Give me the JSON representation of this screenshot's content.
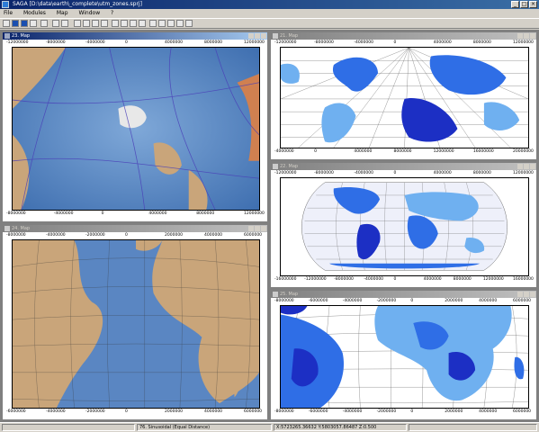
{
  "app": {
    "title": "SAGA [D:\\data\\earth\\_complete\\utm_zones.sprj]"
  },
  "menu": [
    "File",
    "Modules",
    "Map",
    "Window",
    "?"
  ],
  "windows": [
    {
      "title": "23. Map",
      "top_ticks": [
        "-12000000",
        "-8000000",
        "-4000000",
        "0",
        "4000000",
        "8000000",
        "12000000"
      ],
      "bottom_ticks": [
        "-8000000",
        "-4000000",
        "0",
        "4000000",
        "8000000",
        "12000000"
      ]
    },
    {
      "title": "24. Map",
      "top_ticks": [
        "-8000000",
        "-4000000",
        "-2000000",
        "0",
        "2000000",
        "4000000",
        "6000000"
      ],
      "bottom_ticks": [
        "-6000000",
        "-4000000",
        "-2000000",
        "0",
        "2000000",
        "4000000",
        "6000000"
      ]
    },
    {
      "title": "21. Map",
      "top_ticks": [
        "-12000000",
        "-8000000",
        "-4000000",
        "0",
        "4000000",
        "8000000",
        "12000000"
      ],
      "bottom_ticks": [
        "-4000000",
        "0",
        "4000000",
        "8000000",
        "12000000",
        "16000000",
        "20000000"
      ]
    },
    {
      "title": "22. Map",
      "top_ticks": [
        "-12000000",
        "-8000000",
        "-4000000",
        "0",
        "4000000",
        "8000000",
        "12000000"
      ],
      "bottom_ticks": [
        "-16000000",
        "-12000000",
        "-8000000",
        "-4000000",
        "0",
        "4000000",
        "8000000",
        "12000000",
        "16000000"
      ]
    },
    {
      "title": "25. Map",
      "top_ticks": [
        "-8000000",
        "-6000000",
        "-4000000",
        "-2000000",
        "0",
        "2000000",
        "4000000",
        "6000000"
      ],
      "bottom_ticks": [
        "-8000000",
        "-6000000",
        "-4000000",
        "-2000000",
        "0",
        "2000000",
        "4000000",
        "6000000"
      ]
    }
  ],
  "status": {
    "layer": "76. Sinusoidal (Equal Distance)",
    "coords": "X:5723265.36632 Y:5803057.86487 Z:0.500"
  },
  "colors": {
    "title_active": "#0a246a",
    "zone_light": "#6fb0f0",
    "zone_mid": "#2f6ee6",
    "zone_dark": "#1c2fc4",
    "ocean_relief": "#4f7fbf",
    "land_relief": "#c8a070"
  }
}
